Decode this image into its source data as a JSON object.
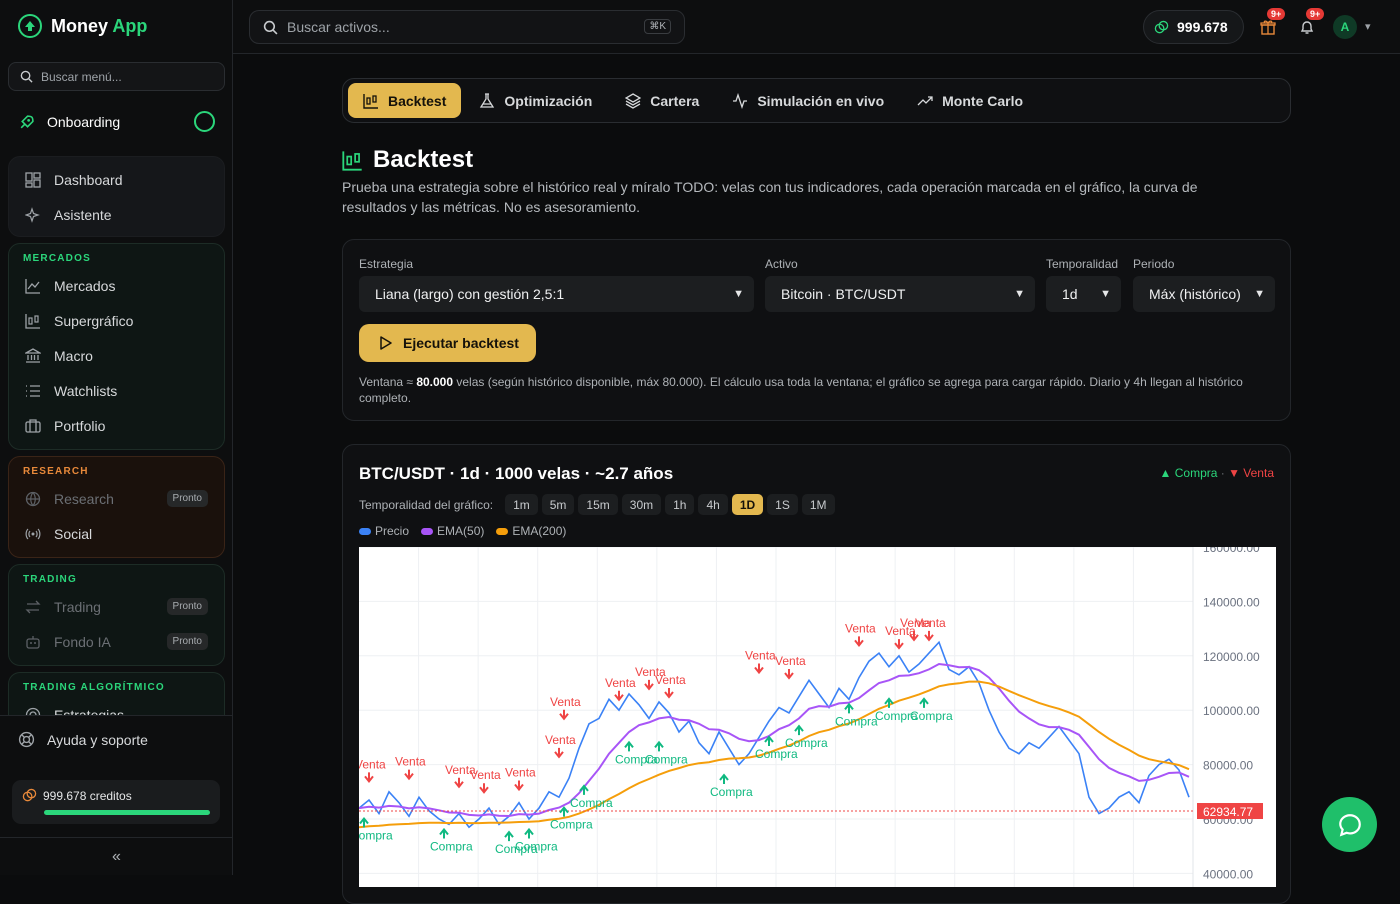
{
  "app": {
    "name_1": "Money",
    "name_2": "App"
  },
  "sidebar": {
    "search_placeholder": "Buscar menú...",
    "onboarding": "Onboarding",
    "main": [
      {
        "label": "Dashboard"
      },
      {
        "label": "Asistente"
      }
    ],
    "groups": [
      {
        "title": "MERCADOS",
        "color": "#2bd67b",
        "items": [
          {
            "label": "Mercados"
          },
          {
            "label": "Supergráfico"
          },
          {
            "label": "Macro"
          },
          {
            "label": "Watchlists"
          },
          {
            "label": "Portfolio"
          }
        ]
      },
      {
        "title": "RESEARCH",
        "color": "#e8893a",
        "items": [
          {
            "label": "Research",
            "badge": "Pronto"
          },
          {
            "label": "Social"
          }
        ]
      },
      {
        "title": "TRADING",
        "color": "#2bd67b",
        "items": [
          {
            "label": "Trading",
            "badge": "Pronto"
          },
          {
            "label": "Fondo IA",
            "badge": "Pronto"
          }
        ]
      },
      {
        "title": "TRADING ALGORÍTMICO",
        "color": "#2bd67b",
        "items": [
          {
            "label": "Estrategias"
          }
        ]
      }
    ],
    "help": "Ayuda y soporte",
    "credits": "999.678 creditos",
    "collapse": "«"
  },
  "topbar": {
    "search_placeholder": "Buscar activos...",
    "shortcut": "⌘K",
    "balance": "999.678",
    "gift_badge": "9+",
    "bell_badge": "9+",
    "avatar": "A"
  },
  "tabs": [
    {
      "label": "Backtest",
      "icon": "candles-icon"
    },
    {
      "label": "Optimización",
      "icon": "flask-icon"
    },
    {
      "label": "Cartera",
      "icon": "layers-icon"
    },
    {
      "label": "Simulación en vivo",
      "icon": "pulse-icon"
    },
    {
      "label": "Monte Carlo",
      "icon": "trend-icon"
    }
  ],
  "page": {
    "title": "Backtest",
    "description": "Prueba una estrategia sobre el histórico real y míralo TODO: velas con tus indicadores, cada operación marcada en el gráfico, la curva de resultados y las métricas. No es asesoramiento."
  },
  "form": {
    "strategy_label": "Estrategia",
    "strategy_value": "Liana (largo) con gestión 2,5:1",
    "asset_label": "Activo",
    "asset_value": "Bitcoin · BTC/USDT",
    "timeframe_label": "Temporalidad",
    "timeframe_value": "1d",
    "period_label": "Periodo",
    "period_value": "Máx (histórico)",
    "run_label": "Ejecutar backtest",
    "note_1": "Ventana ≈ ",
    "note_bold": "80.000",
    "note_2": " velas (según histórico disponible, máx 80.000). El cálculo usa toda la ventana; el gráfico se agrega para cargar rápido. Diario y 4h llegan al histórico completo."
  },
  "chart_card": {
    "title": "BTC/USDT · 1d · 1000 velas · ~2.7 años",
    "buy_legend": "▲ Compra",
    "sep": " · ",
    "sell_legend": "▼ Venta",
    "tf_label": "Temporalidad del gráfico:",
    "timeframes": [
      "1m",
      "5m",
      "15m",
      "30m",
      "1h",
      "4h",
      "1D",
      "1S",
      "1M"
    ],
    "active_tf": "1D",
    "series_legend": [
      {
        "name": "Precio",
        "color": "#3b82f6"
      },
      {
        "name": "EMA(50)",
        "color": "#a855f7"
      },
      {
        "name": "EMA(200)",
        "color": "#f59e0b"
      }
    ]
  },
  "chart_data": {
    "type": "line",
    "ylim": [
      35000,
      160000
    ],
    "yticks": [
      40000,
      60000,
      80000,
      100000,
      120000,
      140000,
      160000
    ],
    "ytick_labels": [
      "40000.00",
      "60000.00",
      "80000.00",
      "100000.00",
      "120000.00",
      "140000.00",
      "160000.00"
    ],
    "last_price_label": "62934.77",
    "last_price": 62934.77,
    "x": [
      0,
      10,
      20,
      30,
      40,
      50,
      60,
      70,
      80,
      90,
      100,
      110,
      120,
      130,
      140,
      150,
      160,
      170,
      180,
      190,
      200,
      210,
      220,
      230,
      240,
      250,
      260,
      270,
      280,
      290,
      300,
      310,
      320,
      330,
      340,
      350,
      360,
      370,
      380,
      390,
      400,
      410,
      420,
      430,
      440,
      450,
      460,
      470,
      480,
      490,
      500,
      510,
      520,
      530,
      540,
      550,
      560,
      570,
      580,
      590,
      600,
      610,
      620,
      630,
      640,
      650,
      660,
      670,
      680,
      690,
      700,
      710,
      720,
      730,
      740,
      750,
      760,
      770,
      780,
      790,
      800,
      810,
      820,
      830
    ],
    "series": [
      {
        "name": "Precio",
        "values": [
          64000,
          67000,
          62000,
          70000,
          66000,
          61000,
          68000,
          63000,
          60000,
          58000,
          62000,
          57000,
          60000,
          64000,
          58000,
          61000,
          66000,
          60000,
          64000,
          70000,
          68000,
          75000,
          86000,
          95000,
          97000,
          104000,
          100000,
          106000,
          102000,
          97000,
          103000,
          99000,
          92000,
          96000,
          88000,
          84000,
          92000,
          86000,
          80000,
          84000,
          90000,
          96000,
          101000,
          99000,
          105000,
          111000,
          106000,
          101000,
          108000,
          104000,
          112000,
          118000,
          121000,
          116000,
          120000,
          114000,
          117000,
          121000,
          125000,
          115000,
          113000,
          116000,
          110000,
          100000,
          92000,
          86000,
          84000,
          88000,
          86000,
          90000,
          94000,
          89000,
          84000,
          68000,
          62000,
          64000,
          68000,
          70000,
          66000,
          76000,
          80000,
          82000,
          78000,
          68000,
          64000,
          60000,
          62000
        ],
        "color": "#3b82f6"
      },
      {
        "name": "EMA(50)",
        "values": [
          64000,
          64500,
          64200,
          64800,
          64600,
          63900,
          64300,
          63900,
          63200,
          62400,
          62300,
          61500,
          61300,
          61700,
          61200,
          61100,
          61800,
          61600,
          62000,
          63300,
          64200,
          66000,
          69500,
          74000,
          78500,
          84000,
          88000,
          92000,
          94500,
          95500,
          97000,
          97500,
          96500,
          96300,
          95000,
          93000,
          92800,
          91500,
          89500,
          88600,
          89000,
          90500,
          93000,
          94500,
          97000,
          100500,
          101500,
          101300,
          102500,
          102800,
          104500,
          107300,
          110000,
          111000,
          112600,
          112800,
          113600,
          115000,
          117000,
          116500,
          115800,
          115900,
          114700,
          112000,
          108000,
          103500,
          99500,
          97000,
          94800,
          93800,
          93800,
          92800,
          91000,
          86500,
          82000,
          78800,
          77000,
          75700,
          74000,
          74400,
          75500,
          76900,
          77100,
          75500,
          73300,
          70500,
          68800
        ],
        "color": "#a855f7"
      },
      {
        "name": "EMA(200)",
        "values": [
          57000,
          57300,
          57500,
          57900,
          58100,
          58200,
          58500,
          58600,
          58600,
          58500,
          58600,
          58500,
          58500,
          58600,
          58600,
          58700,
          58900,
          59000,
          59200,
          59700,
          60100,
          60800,
          62000,
          63500,
          65200,
          67300,
          69200,
          71300,
          73200,
          74700,
          76300,
          77700,
          78700,
          79800,
          80500,
          80900,
          81700,
          82200,
          82300,
          82600,
          83300,
          84400,
          85800,
          87000,
          88600,
          90500,
          91900,
          92800,
          94100,
          95100,
          96700,
          98600,
          100500,
          101900,
          103500,
          104600,
          105800,
          107200,
          108800,
          109500,
          109900,
          110500,
          110500,
          109900,
          108700,
          107100,
          105500,
          104100,
          102700,
          101500,
          100500,
          99200,
          97600,
          94800,
          92000,
          89500,
          87300,
          85400,
          83300,
          82000,
          81200,
          80600,
          79800,
          78300,
          76600,
          74700,
          73100
        ],
        "color": "#f59e0b"
      }
    ],
    "buy_label": "Compra",
    "sell_label": "Venta",
    "buys": [
      {
        "x": 5,
        "y": 62000
      },
      {
        "x": 85,
        "y": 58000
      },
      {
        "x": 150,
        "y": 57000
      },
      {
        "x": 170,
        "y": 58000
      },
      {
        "x": 205,
        "y": 66000
      },
      {
        "x": 225,
        "y": 74000
      },
      {
        "x": 270,
        "y": 90000
      },
      {
        "x": 300,
        "y": 90000
      },
      {
        "x": 365,
        "y": 78000
      },
      {
        "x": 410,
        "y": 92000
      },
      {
        "x": 440,
        "y": 96000
      },
      {
        "x": 490,
        "y": 104000
      },
      {
        "x": 530,
        "y": 106000
      },
      {
        "x": 565,
        "y": 106000
      }
    ],
    "sells": [
      {
        "x": 10,
        "y": 72000
      },
      {
        "x": 50,
        "y": 73000
      },
      {
        "x": 100,
        "y": 70000
      },
      {
        "x": 125,
        "y": 68000
      },
      {
        "x": 160,
        "y": 69000
      },
      {
        "x": 200,
        "y": 81000
      },
      {
        "x": 205,
        "y": 95000
      },
      {
        "x": 260,
        "y": 102000
      },
      {
        "x": 290,
        "y": 106000
      },
      {
        "x": 310,
        "y": 103000
      },
      {
        "x": 400,
        "y": 112000
      },
      {
        "x": 430,
        "y": 110000
      },
      {
        "x": 500,
        "y": 122000
      },
      {
        "x": 540,
        "y": 121000
      },
      {
        "x": 555,
        "y": 124000
      },
      {
        "x": 570,
        "y": 124000
      }
    ]
  }
}
